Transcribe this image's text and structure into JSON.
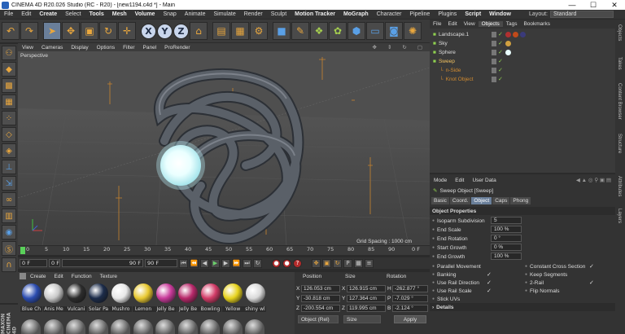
{
  "window": {
    "title": "CINEMA 4D R20.026 Studio (RC - R20) - [new1194.c4d *] - Main",
    "minimize": "—",
    "maximize": "☐",
    "close": "✕"
  },
  "menu": {
    "items": [
      "File",
      "Edit",
      "Create",
      "Select",
      "Tools",
      "Mesh",
      "Volume",
      "Snap",
      "Animate",
      "Simulate",
      "Render",
      "Sculpt",
      "Motion Tracker",
      "MoGraph",
      "Character",
      "Pipeline",
      "Plugins",
      "Script",
      "Window"
    ],
    "layout_label": "Layout:",
    "layout_value": "Standard"
  },
  "toolbar": {
    "axis_x": "X",
    "axis_y": "Y",
    "axis_z": "Z"
  },
  "viewport": {
    "menu": [
      "View",
      "Cameras",
      "Display",
      "Options",
      "Filter",
      "Panel",
      "ProRender"
    ],
    "label": "Perspective",
    "grid_spacing": "Grid Spacing : 1000 cm",
    "colors": {
      "background": "#4b4b4b",
      "object": "#5a6068",
      "sphere": "#eaffff"
    }
  },
  "timeline": {
    "ticks": [
      "0",
      "5",
      "10",
      "15",
      "20",
      "25",
      "30",
      "35",
      "40",
      "45",
      "50",
      "55",
      "60",
      "65",
      "70",
      "75",
      "80",
      "85",
      "90"
    ],
    "end_label": "0 F"
  },
  "playback": {
    "current": "0 F",
    "start": "0 F",
    "end_a": "90 F",
    "end_b": "90 F"
  },
  "materials": {
    "menu": [
      "Create",
      "Edit",
      "Function",
      "Texture"
    ],
    "items": [
      {
        "name": "Blue Ch",
        "color": "#2b4cb0"
      },
      {
        "name": "Anis Me",
        "color": "#c9c9c9"
      },
      {
        "name": "Vulcani",
        "color": "#2d2d2d"
      },
      {
        "name": "Solar Pa",
        "color": "#1c2c4a"
      },
      {
        "name": "Mushro",
        "color": "#e8e8e8"
      },
      {
        "name": "Lemon",
        "color": "#e8c830"
      },
      {
        "name": "Jelly Be",
        "color": "#c83a9a"
      },
      {
        "name": "Jelly Be",
        "color": "#b8286a"
      },
      {
        "name": "Bowling",
        "color": "#d23b67"
      },
      {
        "name": "Yellow",
        "color": "#e6d21c"
      },
      {
        "name": "shiny wl",
        "color": "#dadada"
      }
    ],
    "logo": "MAXON CINEMA 4D"
  },
  "coordinates": {
    "headers": {
      "position": "Position",
      "size": "Size",
      "rotation": "Rotation"
    },
    "rows": [
      {
        "axis": "X",
        "pos": "126.053 cm",
        "size_axis": "X",
        "size": "126.915 cm",
        "rot_axis": "H",
        "rot": "-262.877 °"
      },
      {
        "axis": "Y",
        "pos": "-30.818 cm",
        "size_axis": "Y",
        "size": "127.364 cm",
        "rot_axis": "P",
        "rot": "-7.029 °"
      },
      {
        "axis": "Z",
        "pos": "-200.554 cm",
        "size_axis": "Z",
        "size": "119.995 cm",
        "rot_axis": "B",
        "rot": "-2.124 °"
      }
    ],
    "mode": "Object (Rel)",
    "size_mode": "Size",
    "apply": "Apply"
  },
  "objects": {
    "tabs": [
      "File",
      "Edit",
      "View",
      "Objects",
      "Tags",
      "Bookmarks"
    ],
    "items": [
      {
        "name": "Landscape.1",
        "color": "#dddddd",
        "indent": 0,
        "tags": [
          "#b03030",
          "#c04a1a",
          "#3a3a7a"
        ]
      },
      {
        "name": "Sky",
        "color": "#dddddd",
        "indent": 0,
        "tags": [
          "#d0a040"
        ]
      },
      {
        "name": "Sphere",
        "color": "#dddddd",
        "indent": 0,
        "tags": [
          "#eaffff"
        ]
      },
      {
        "name": "Sweep",
        "color": "#f0c060",
        "indent": 0,
        "tags": []
      },
      {
        "name": "n-Side",
        "color": "#d08a30",
        "indent": 1,
        "tags": []
      },
      {
        "name": "Knot Object",
        "color": "#d08a30",
        "indent": 1,
        "tags": []
      }
    ]
  },
  "side_tabs": [
    "Objects",
    "Takes",
    "Content Browser",
    "Structure",
    "Attributes",
    "Layers"
  ],
  "attributes": {
    "menu": [
      "Mode",
      "Edit",
      "User Data"
    ],
    "title": "Sweep Object [Sweep]",
    "tabs": [
      "Basic",
      "Coord.",
      "Object",
      "Caps",
      "Phong"
    ],
    "active_tab": "Object",
    "section": "Object Properties",
    "props": [
      {
        "label": "Isoparm Subdivision",
        "value": "5"
      },
      {
        "label": "End Scale",
        "value": "100 %"
      },
      {
        "label": "End Rotation",
        "value": "0 °"
      },
      {
        "label": "Start Growth",
        "value": "0 %"
      },
      {
        "label": "End Growth",
        "value": "100 %"
      }
    ],
    "checks_left": [
      {
        "label": "Parallel Movement",
        "checked": false
      },
      {
        "label": "Banking",
        "checked": true
      },
      {
        "label": "Use Rail Direction",
        "checked": true
      },
      {
        "label": "Use Rail Scale",
        "checked": true
      },
      {
        "label": "Stick UVs",
        "checked": false
      }
    ],
    "checks_right": [
      {
        "label": "Constant Cross Section",
        "checked": true
      },
      {
        "label": "Keep Segments",
        "checked": false
      },
      {
        "label": "2-Rail",
        "checked": true
      },
      {
        "label": "Flip Normals",
        "checked": false
      }
    ],
    "details": "Details"
  }
}
